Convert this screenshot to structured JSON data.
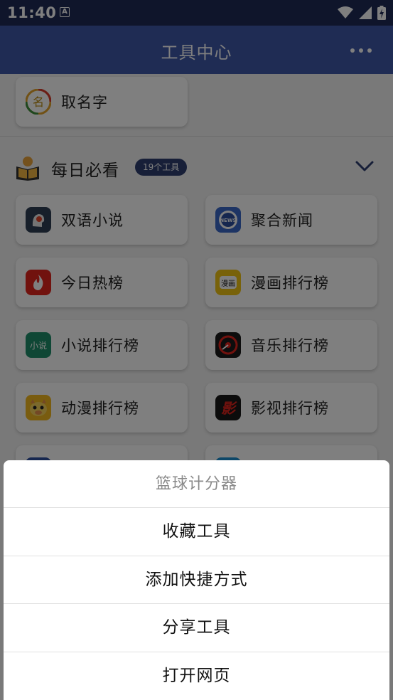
{
  "status_bar": {
    "time": "11:40",
    "notif_icon": "A"
  },
  "app_bar": {
    "title": "工具中心"
  },
  "top_tile": {
    "label": "取名字",
    "icon": "naming-icon"
  },
  "section": {
    "title": "每日必看",
    "badge": "19个工具"
  },
  "tiles": [
    {
      "label": "双语小说",
      "icon": "bilingual-novel-icon",
      "color": "#2f3e55"
    },
    {
      "label": "聚合新闻",
      "icon": "news-icon",
      "color": "#3b69c9"
    },
    {
      "label": "今日热榜",
      "icon": "hot-list-icon",
      "color": "#e3241c"
    },
    {
      "label": "漫画排行榜",
      "icon": "comic-icon",
      "color": "#f0c415"
    },
    {
      "label": "小说排行榜",
      "icon": "novel-rank-icon",
      "color": "#1f8f6a",
      "glyph": "小说"
    },
    {
      "label": "音乐排行榜",
      "icon": "music-icon",
      "color": "#1a1a1a"
    },
    {
      "label": "动漫排行榜",
      "icon": "anime-icon",
      "color": "#f2b91f"
    },
    {
      "label": "影视排行榜",
      "icon": "movie-icon",
      "color": "#181818",
      "glyph": "影"
    }
  ],
  "sheet": {
    "title": "篮球计分器",
    "items": [
      "收藏工具",
      "添加快捷方式",
      "分享工具",
      "打开网页"
    ]
  }
}
